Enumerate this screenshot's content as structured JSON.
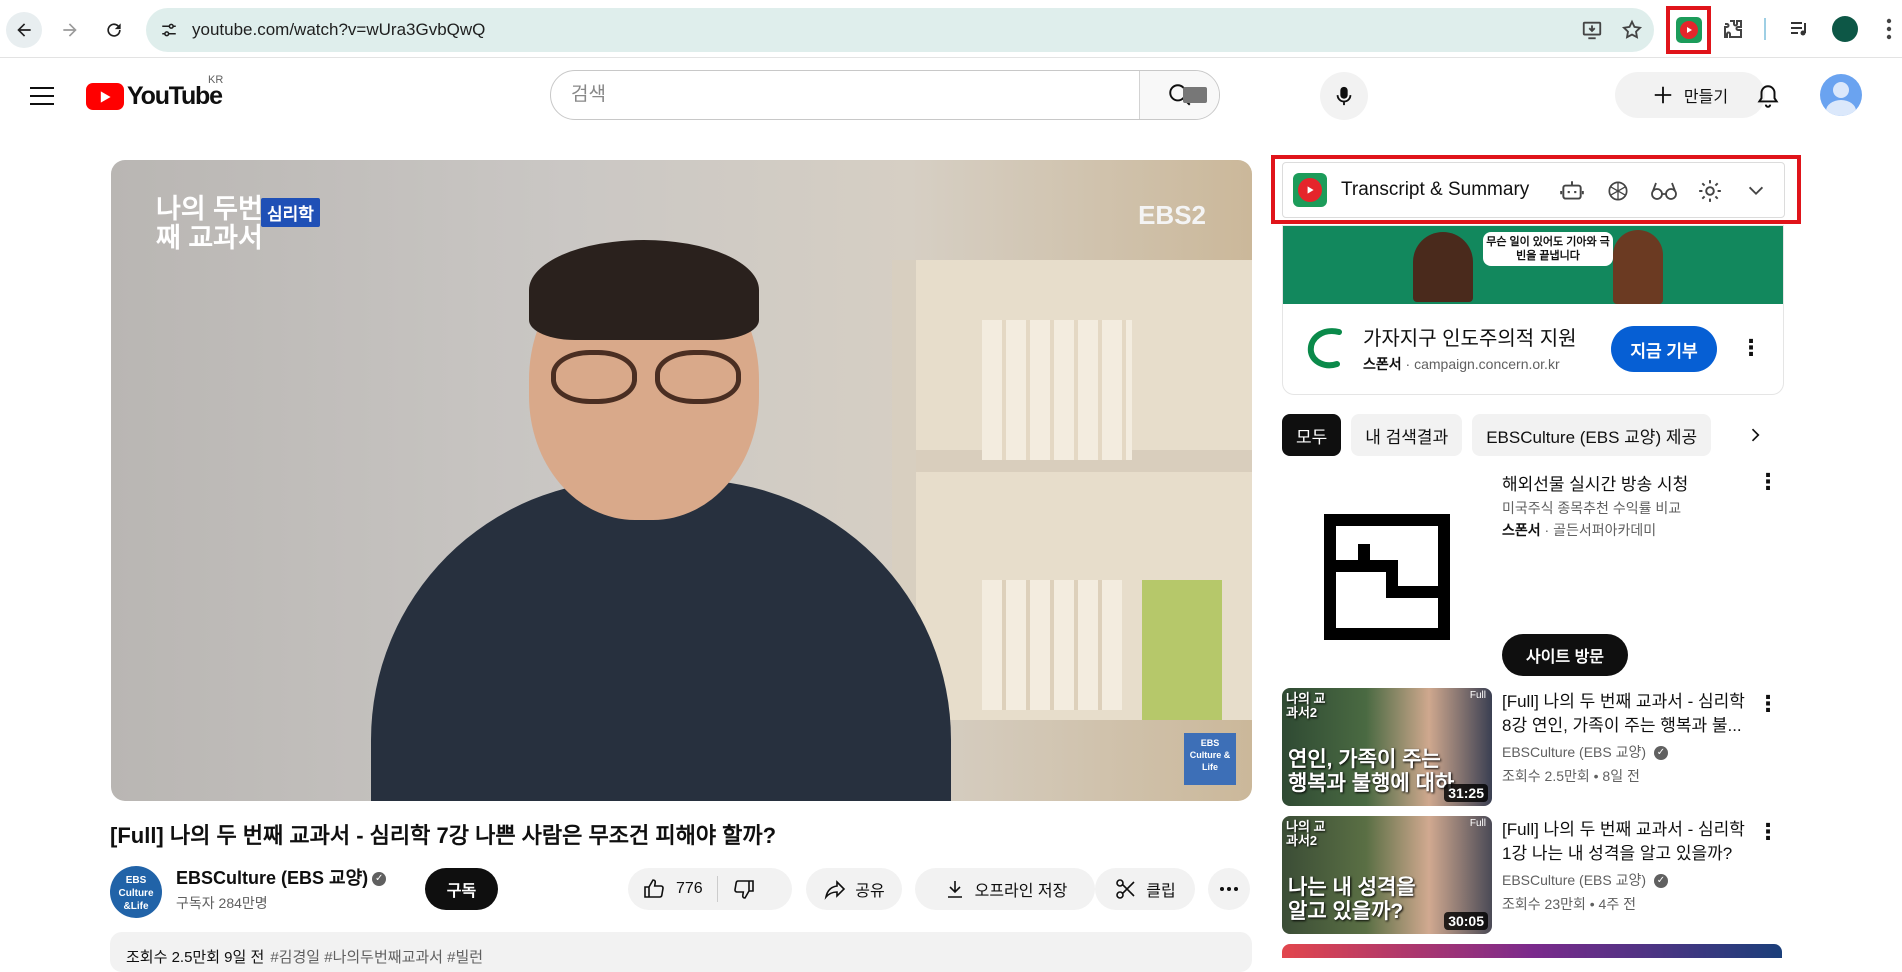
{
  "browser": {
    "url": "youtube.com/watch?v=wUra3GvbQwQ",
    "icons": [
      "back-icon",
      "forward-icon",
      "reload-icon",
      "site-info-icon",
      "install-app-icon",
      "bookmark-star-icon",
      "extension-icon",
      "puzzle-icon",
      "media-queue-icon",
      "profile-icon",
      "more-icon"
    ]
  },
  "header": {
    "logo_text": "YouTube",
    "region": "KR",
    "search_placeholder": "검색",
    "create_label": "만들기"
  },
  "player": {
    "overlay_show_title": "나의 두번째 교과서",
    "overlay_badge": "심리학",
    "overlay_channel_mark": "EBS2",
    "corner_logo": "EBS Culture & Life"
  },
  "video": {
    "title": "[Full] 나의 두 번째 교과서 - 심리학 7강 나쁜 사람은 무조건 피해야 할까?",
    "channel": "EBSCulture (EBS 교양)",
    "channel_avatar_text": "EBS Culture &Life",
    "subscribers": "구독자 284만명",
    "subscribe_label": "구독",
    "likes": "776",
    "share_label": "공유",
    "offline_label": "오프라인 저장",
    "clip_label": "클립",
    "description_line": "조회수 2.5만회  9일 전",
    "description_tags": "#김경일 #나의두번째교과서 #빌런"
  },
  "extension_panel": {
    "title": "Transcript & Summary",
    "tools": [
      "robot-icon",
      "chatgpt-icon",
      "glasses-icon",
      "settings-icon",
      "chevron-down-icon"
    ]
  },
  "ad": {
    "banner_text": "무슨 일이 있어도 기아와 극빈을 끝냅니다",
    "title": "가자지구 인도주의적 지원",
    "sponsor_label": "스폰서",
    "sponsor_domain": "campaign.concern.or.kr",
    "donate_label": "지금 기부"
  },
  "chips": [
    "모두",
    "내 검색결과",
    "EBSCulture (EBS 교양) 제공"
  ],
  "sponsored_item": {
    "title": "해외선물 실시간 방송 시청",
    "subtitle": "미국주식 종목추천 수익률 비교",
    "sponsor_label": "스폰서",
    "sponsor_name": "골든서퍼아카데미",
    "visit_label": "사이트 방문"
  },
  "recommendations": [
    {
      "title": "[Full] 나의 두 번째 교과서 - 심리학 8강 연인, 가족이 주는 행복과 불...",
      "channel": "EBSCulture (EBS 교양)",
      "meta": "조회수 2.5만회 • 8일 전",
      "duration": "31:25",
      "thumb_text_1": "연인, 가족이 주는",
      "thumb_text_2": "행복과 불행에 대하",
      "thumb_logo": "나의 교과서2",
      "thumb_tag": "Full"
    },
    {
      "title": "[Full] 나의 두 번째 교과서 - 심리학 1강 나는 내 성격을 알고 있을까?",
      "channel": "EBSCulture (EBS 교양)",
      "meta": "조회수 23만회 • 4주 전",
      "duration": "30:05",
      "thumb_text_1": "나는 내 성격을",
      "thumb_text_2": "알고 있을까?",
      "thumb_logo": "나의 교과서2",
      "thumb_tag": "Full"
    }
  ],
  "colors": {
    "brand_red": "#ff0000",
    "highlight_red": "#e0141a",
    "subscribe_bg": "#0f0f0f",
    "donate_blue": "#065fd4",
    "omnibox_bg": "#dfeeec"
  }
}
